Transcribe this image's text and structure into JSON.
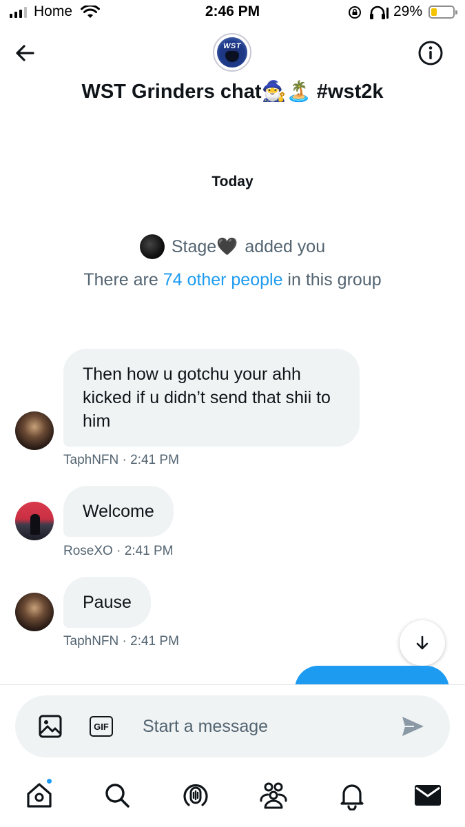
{
  "status_bar": {
    "carrier": "Home",
    "time": "2:46 PM",
    "battery_percent": "29%",
    "battery_level": 0.29,
    "battery_color": "#f4c400",
    "icons": [
      "signal-icon",
      "wifi-icon",
      "rotation-lock-icon",
      "headphones-icon",
      "battery-icon"
    ]
  },
  "header": {
    "title": "WST Grinders chat🧙‍♂️🏝️ #wst2k",
    "avatar_text": "WST",
    "back_icon": "arrow-left-icon",
    "info_icon": "info-icon"
  },
  "conversation": {
    "date_divider": "Today",
    "added_event": {
      "actor": "Stage",
      "emoji": "🖤",
      "text": "added you"
    },
    "group_info": {
      "prefix": "There are ",
      "link": "74 other people",
      "suffix": " in this group"
    },
    "messages": [
      {
        "text": "Then how u gotchu your ahh kicked if u didn’t send that shii to him",
        "author": "TaphNFN",
        "time": "2:41 PM",
        "meta": "TaphNFN · 2:41 PM"
      },
      {
        "text": "Welcome",
        "author": "RoseXO",
        "time": "2:41 PM",
        "meta": "RoseXO · 2:41 PM"
      },
      {
        "text": "Pause",
        "author": "TaphNFN",
        "time": "2:41 PM",
        "meta": "TaphNFN · 2:41 PM"
      }
    ],
    "scroll_icon": "arrow-down-icon"
  },
  "composer": {
    "placeholder": "Start a message",
    "value": "",
    "gif_label": "GIF",
    "icons": [
      "image-icon",
      "gif-icon",
      "send-icon"
    ]
  },
  "tab_bar": {
    "tabs": [
      "home",
      "search",
      "spaces",
      "communities",
      "notifications",
      "messages"
    ],
    "active": "messages",
    "home_has_notification": true
  },
  "colors": {
    "accent": "#1d9bf0",
    "bubble_background": "#eff3f4",
    "secondary_text": "#536471",
    "primary_text": "#0f1419"
  }
}
